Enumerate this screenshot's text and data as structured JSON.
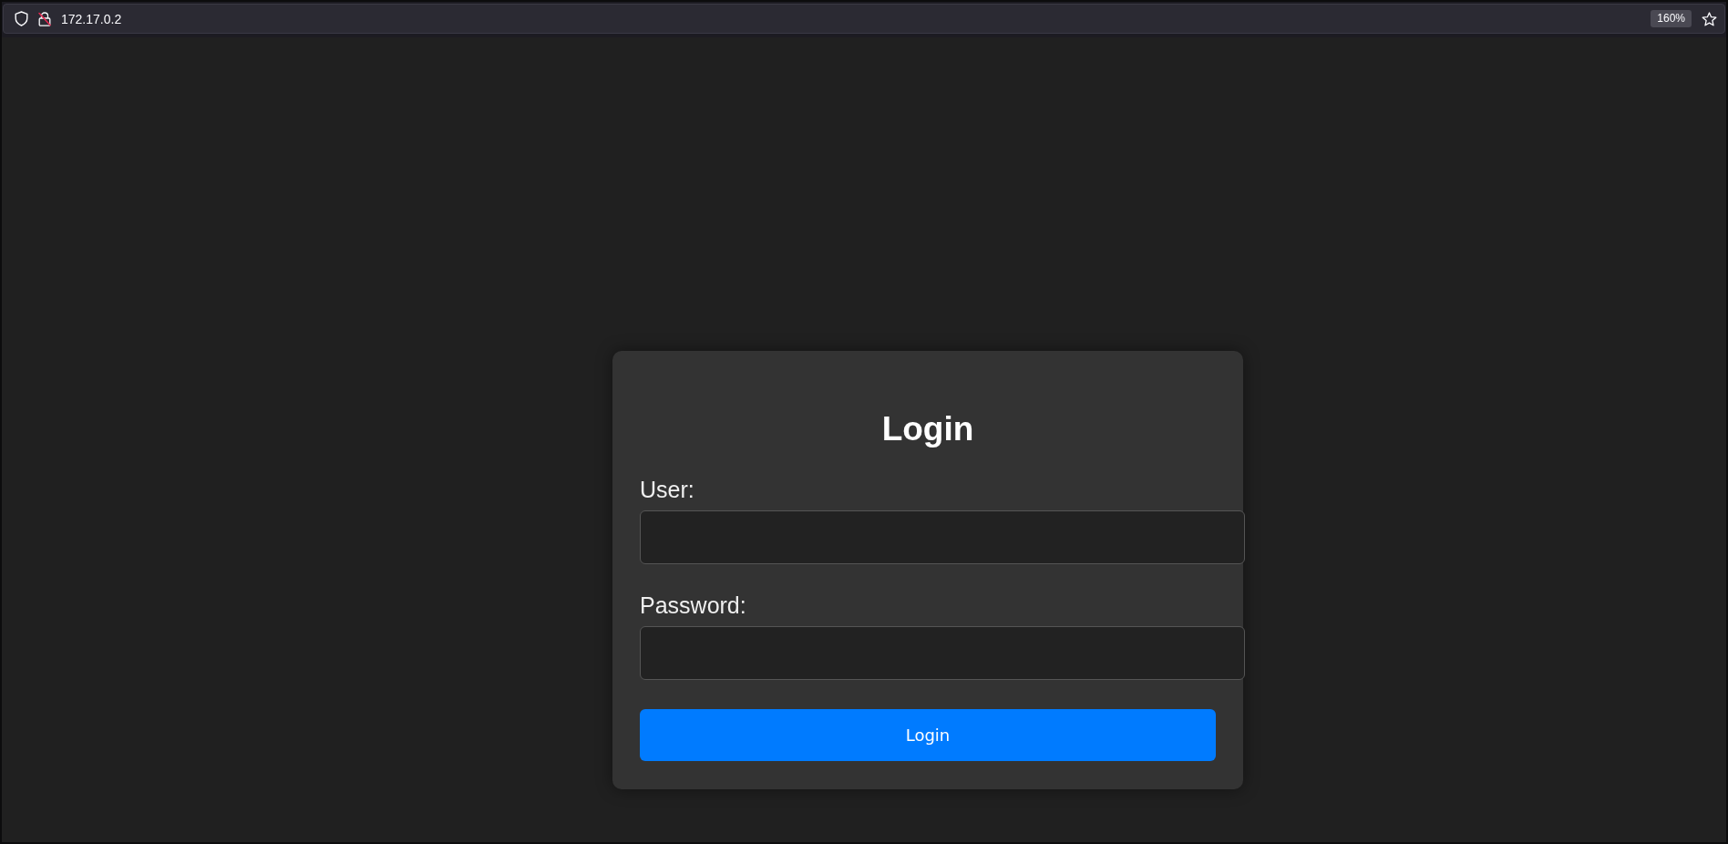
{
  "browser": {
    "url": "172.17.0.2",
    "zoom": "160%"
  },
  "login_form": {
    "title": "Login",
    "fields": [
      {
        "label": "User:"
      },
      {
        "label": "Password:"
      }
    ],
    "button": "Login"
  }
}
